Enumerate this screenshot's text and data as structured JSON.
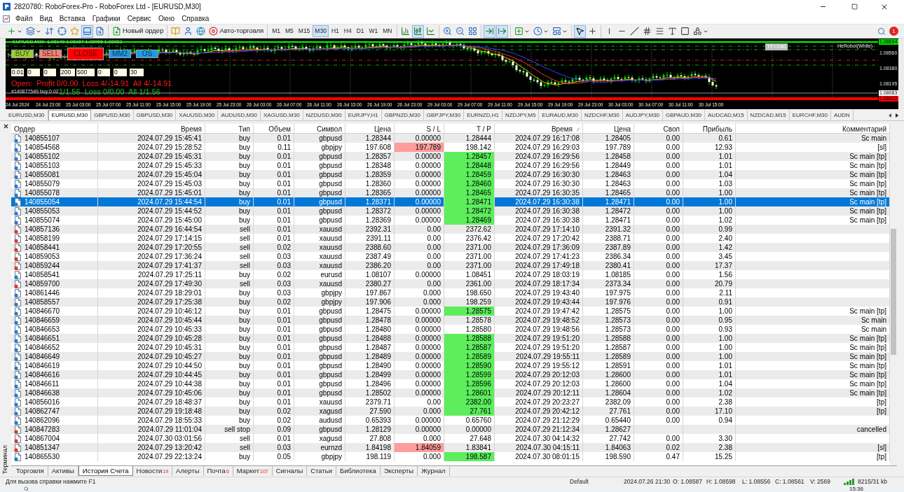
{
  "window": {
    "title": "2820780: RoboForex-Pro - RoboForex Ltd - [EURUSD,M30]"
  },
  "menu": [
    "Файл",
    "Вид",
    "Вставка",
    "Графики",
    "Сервис",
    "Окно",
    "Справка"
  ],
  "toolbar": {
    "groups": [
      [
        {
          "kind": "new-chart",
          "selected": false
        },
        {
          "kind": "profiles",
          "selected": false
        },
        {
          "kind": "market-watch",
          "selected": false
        },
        {
          "kind": "data-window",
          "selected": false
        },
        {
          "kind": "navigator",
          "selected": false
        },
        {
          "kind": "terminal",
          "selected": true
        },
        {
          "kind": "tester",
          "selected": false
        }
      ],
      [
        {
          "kind": "new-order",
          "label": "Новый ордер",
          "selected": false
        }
      ],
      [
        {
          "kind": "editor",
          "selected": false
        },
        {
          "kind": "user",
          "selected": false
        },
        {
          "kind": "globe",
          "selected": false
        },
        {
          "kind": "auto-trading",
          "label": "Авто-торговля",
          "selected": false
        }
      ],
      [
        {
          "kind": "timeframe",
          "label": "M1",
          "selected": false
        },
        {
          "kind": "timeframe",
          "label": "M5",
          "selected": false
        },
        {
          "kind": "timeframe",
          "label": "M15",
          "selected": false
        },
        {
          "kind": "timeframe",
          "label": "M30",
          "selected": true
        },
        {
          "kind": "timeframe",
          "label": "H1",
          "selected": false
        },
        {
          "kind": "timeframe",
          "label": "H4",
          "selected": false
        },
        {
          "kind": "timeframe",
          "label": "D1",
          "selected": false
        },
        {
          "kind": "timeframe",
          "label": "W1",
          "selected": false
        },
        {
          "kind": "timeframe",
          "label": "MN",
          "selected": false
        }
      ],
      [
        {
          "kind": "bars",
          "selected": false
        },
        {
          "kind": "candles",
          "selected": true
        },
        {
          "kind": "line",
          "selected": false
        }
      ],
      [
        {
          "kind": "zoom-in",
          "selected": false
        },
        {
          "kind": "zoom-out",
          "selected": false
        },
        {
          "kind": "tile",
          "selected": false
        }
      ],
      [
        {
          "kind": "autoscroll",
          "selected": true
        },
        {
          "kind": "shift",
          "selected": true
        }
      ],
      [
        {
          "kind": "indicators",
          "selected": false
        },
        {
          "kind": "periods",
          "selected": false
        },
        {
          "kind": "templates",
          "selected": false
        }
      ],
      [
        {
          "kind": "cursor",
          "selected": true
        },
        {
          "kind": "crosshair",
          "selected": false
        }
      ],
      [
        {
          "kind": "vline",
          "selected": false
        },
        {
          "kind": "hline",
          "selected": false
        },
        {
          "kind": "trendline",
          "selected": false
        },
        {
          "kind": "channel",
          "selected": false
        },
        {
          "kind": "fibo",
          "selected": false
        },
        {
          "kind": "text",
          "selected": false
        },
        {
          "kind": "label",
          "selected": false
        },
        {
          "kind": "shapes",
          "selected": false
        }
      ]
    ],
    "notification_count": "1"
  },
  "chart": {
    "info_line": "EURUSD,M30  1.08149 1.08187 1.08066 1.08083",
    "buttons": [
      {
        "label": "BUY",
        "color": "#9acd32"
      },
      {
        "label": "SELL",
        "color": "#fa8072"
      },
      {
        "label": "CLOSE",
        "color": "#ff0000"
      },
      {
        "label": "MM2",
        "color": "#1e9be6"
      },
      {
        "label": "OS",
        "color": "#1e9be6"
      }
    ],
    "inputs": [
      "0.01",
      "0",
      "0",
      "200",
      "500",
      "0",
      "0",
      "30"
    ],
    "open_summary": "Open:  Profit 0/0.00  Loss 4/-14.91  All 4/-14.91",
    "order_note": "#140877549 buy 0.02",
    "closed_summary": "1/1.56  Loss 0/0.00  All 1/1.56",
    "tf_label": "TF=240",
    "robot_label": "HeRobot(White)",
    "price_labels": [
      {
        "text": "1.08694",
        "kind": "boxed",
        "color": "#00e000"
      },
      {
        "text": "1.08560",
        "kind": "plain"
      },
      {
        "text": "1.08380",
        "kind": "plain"
      },
      {
        "text": "1.08195",
        "kind": "plain"
      },
      {
        "text": "1.08083",
        "kind": "boxed",
        "color": "#ffffff"
      },
      {
        "text": "1.08022",
        "kind": "boxed",
        "color": "#ff0000"
      }
    ],
    "time_labels": [
      "24 Jul 2024",
      "24 Jul 23:00",
      "25 Jul 03:00",
      "25 Jul 07:00",
      "25 Jul 11:00",
      "25 Jul 15:00",
      "25 Jul 19:00",
      "25 Jul 23:00",
      "26 Jul 03:00",
      "26 Jul 07:00",
      "26 Jul 11:00",
      "26 Jul 15:00",
      "26 Jul 19:00",
      "26 Jul 23:00",
      "29 Jul 03:00",
      "29 Jul 07:00",
      "29 Jul 11:00",
      "29 Jul 15:00",
      "29 Jul 19:00",
      "29 Jul 23:00",
      "30 Jul 03:00",
      "30 Jul 07:00",
      "30 Jul 11:00",
      "30 Jul 15:00"
    ]
  },
  "symbol_tabs": [
    {
      "label": "EURUSD,M30",
      "selected": false
    },
    {
      "label": "EURUSD,M30",
      "selected": true
    },
    {
      "label": "GBPUSD,M30",
      "selected": false
    },
    {
      "label": "GBPUSD,M30",
      "selected": false
    },
    {
      "label": "XAUUSD,M30",
      "selected": false
    },
    {
      "label": "AUDUSD,M30",
      "selected": false
    },
    {
      "label": "XAGUSD,M30",
      "selected": false
    },
    {
      "label": "NZDUSD,M30",
      "selected": false
    },
    {
      "label": "EURJPY,H1",
      "selected": false
    },
    {
      "label": "GBPNZD,M30",
      "selected": false
    },
    {
      "label": "GBPJPY,M30",
      "selected": false
    },
    {
      "label": "EURNZD,H1",
      "selected": false
    },
    {
      "label": "NZDJPY,M5",
      "selected": false
    },
    {
      "label": "EURAUD,M30",
      "selected": false
    },
    {
      "label": "NZDCHF,M30",
      "selected": false
    },
    {
      "label": "AUDJPY,M30",
      "selected": false
    },
    {
      "label": "GBPAUD,M30",
      "selected": false
    },
    {
      "label": "AUDCAD,M15",
      "selected": false
    },
    {
      "label": "NZDCAD,M15",
      "selected": false
    },
    {
      "label": "EURCHF,M30",
      "selected": false
    },
    {
      "label": "AUDN",
      "selected": false
    }
  ],
  "terminal": {
    "label": "Терминал",
    "columns": [
      {
        "label": "Ордер",
        "sorted": false
      },
      {
        "label": "Время",
        "sorted": false
      },
      {
        "label": "Тип",
        "sorted": false
      },
      {
        "label": "Объем",
        "sorted": false
      },
      {
        "label": "Символ",
        "sorted": false
      },
      {
        "label": "Цена",
        "sorted": false
      },
      {
        "label": "S / L",
        "sorted": false
      },
      {
        "label": "T / P",
        "sorted": false
      },
      {
        "label": "Время",
        "sorted": true
      },
      {
        "label": "Цена",
        "sorted": false
      },
      {
        "label": "Своп",
        "sorted": false
      },
      {
        "label": "Прибыль",
        "sorted": false
      },
      {
        "label": "Комментарий",
        "sorted": false
      }
    ],
    "rows": [
      {
        "order": "140855107",
        "open_time": "2024.07.29 15:45:41",
        "type": "buy",
        "volume": "0.01",
        "symbol": "gbpusd",
        "open_price": "1.28344",
        "sl": "0.00000",
        "tp": "1.28444",
        "close_time": "2024.07.29 16:17:08",
        "close_price": "1.28405",
        "swap": "0.00",
        "profit": "0.61",
        "comment": "Sc main",
        "kind": "buy",
        "selected": false,
        "sl_hit": false,
        "tp_hit": false
      },
      {
        "order": "140854568",
        "open_time": "2024.07.29 15:28:52",
        "type": "buy",
        "volume": "0.11",
        "symbol": "gbpjpy",
        "open_price": "197.608",
        "sl": "197.789",
        "tp": "198.142",
        "close_time": "2024.07.29 16:29:03",
        "close_price": "197.789",
        "swap": "0.00",
        "profit": "12.93",
        "comment": "[sl]",
        "kind": "buy",
        "selected": false,
        "sl_hit": true,
        "tp_hit": false
      },
      {
        "order": "140855102",
        "open_time": "2024.07.29 15:45:31",
        "type": "buy",
        "volume": "0.01",
        "symbol": "gbpusd",
        "open_price": "1.28357",
        "sl": "0.00000",
        "tp": "1.28457",
        "close_time": "2024.07.29 16:29:56",
        "close_price": "1.28458",
        "swap": "0.00",
        "profit": "1.01",
        "comment": "Sc main [tp]",
        "kind": "buy",
        "selected": false,
        "sl_hit": false,
        "tp_hit": true
      },
      {
        "order": "140855103",
        "open_time": "2024.07.29 15:45:33",
        "type": "buy",
        "volume": "0.01",
        "symbol": "gbpusd",
        "open_price": "1.28348",
        "sl": "0.00000",
        "tp": "1.28448",
        "close_time": "2024.07.29 16:29:56",
        "close_price": "1.28449",
        "swap": "0.00",
        "profit": "1.01",
        "comment": "Sc main [tp]",
        "kind": "buy",
        "selected": false,
        "sl_hit": false,
        "tp_hit": true
      },
      {
        "order": "140855081",
        "open_time": "2024.07.29 15:45:04",
        "type": "buy",
        "volume": "0.01",
        "symbol": "gbpusd",
        "open_price": "1.28359",
        "sl": "0.00000",
        "tp": "1.28459",
        "close_time": "2024.07.29 16:30:30",
        "close_price": "1.28463",
        "swap": "0.00",
        "profit": "1.04",
        "comment": "Sc main [tp]",
        "kind": "buy",
        "selected": false,
        "sl_hit": false,
        "tp_hit": true
      },
      {
        "order": "140855079",
        "open_time": "2024.07.29 15:45:03",
        "type": "buy",
        "volume": "0.01",
        "symbol": "gbpusd",
        "open_price": "1.28360",
        "sl": "0.00000",
        "tp": "1.28460",
        "close_time": "2024.07.29 16:30:30",
        "close_price": "1.28463",
        "swap": "0.00",
        "profit": "1.03",
        "comment": "Sc main [tp]",
        "kind": "buy",
        "selected": false,
        "sl_hit": false,
        "tp_hit": true
      },
      {
        "order": "140855078",
        "open_time": "2024.07.29 15:45:01",
        "type": "buy",
        "volume": "0.01",
        "symbol": "gbpusd",
        "open_price": "1.28365",
        "sl": "0.00000",
        "tp": "1.28465",
        "close_time": "2024.07.29 16:30:35",
        "close_price": "1.28465",
        "swap": "0.00",
        "profit": "1.00",
        "comment": "Sc main [tp]",
        "kind": "buy",
        "selected": false,
        "sl_hit": false,
        "tp_hit": true
      },
      {
        "order": "140855054",
        "open_time": "2024.07.29 15:44:54",
        "type": "buy",
        "volume": "0.01",
        "symbol": "gbpusd",
        "open_price": "1.28371",
        "sl": "0.00000",
        "tp": "1.28471",
        "close_time": "2024.07.29 16:30:38",
        "close_price": "1.28471",
        "swap": "0.00",
        "profit": "1.00",
        "comment": "Sc main [tp]",
        "kind": "buy",
        "selected": true,
        "sl_hit": false,
        "tp_hit": true
      },
      {
        "order": "140855053",
        "open_time": "2024.07.29 15:44:52",
        "type": "buy",
        "volume": "0.01",
        "symbol": "gbpusd",
        "open_price": "1.28372",
        "sl": "0.00000",
        "tp": "1.28472",
        "close_time": "2024.07.29 16:30:38",
        "close_price": "1.28472",
        "swap": "0.00",
        "profit": "1.00",
        "comment": "Sc main [tp]",
        "kind": "buy",
        "selected": false,
        "sl_hit": false,
        "tp_hit": true
      },
      {
        "order": "140855074",
        "open_time": "2024.07.29 15:45:00",
        "type": "buy",
        "volume": "0.01",
        "symbol": "gbpusd",
        "open_price": "1.28369",
        "sl": "0.00000",
        "tp": "1.28469",
        "close_time": "2024.07.29 16:30:38",
        "close_price": "1.28471",
        "swap": "0.00",
        "profit": "1.02",
        "comment": "Sc main [tp]",
        "kind": "buy",
        "selected": false,
        "sl_hit": false,
        "tp_hit": true
      },
      {
        "order": "140857136",
        "open_time": "2024.07.29 16:44:54",
        "type": "sell",
        "volume": "0.01",
        "symbol": "xauusd",
        "open_price": "2392.31",
        "sl": "0.00",
        "tp": "2372.62",
        "close_time": "2024.07.29 17:14:10",
        "close_price": "2391.32",
        "swap": "0.00",
        "profit": "0.99",
        "kind": "sell",
        "selected": false,
        "sl_hit": false,
        "tp_hit": false
      },
      {
        "order": "140858199",
        "open_time": "2024.07.29 17:14:15",
        "type": "sell",
        "volume": "0.01",
        "symbol": "xauusd",
        "open_price": "2391.11",
        "sl": "0.00",
        "tp": "2376.42",
        "close_time": "2024.07.29 17:20:42",
        "close_price": "2388.71",
        "swap": "0.00",
        "profit": "2.40",
        "kind": "sell",
        "selected": false,
        "sl_hit": false,
        "tp_hit": false
      },
      {
        "order": "140858441",
        "open_time": "2024.07.29 17:20:55",
        "type": "sell",
        "volume": "0.02",
        "symbol": "xauusd",
        "open_price": "2388.60",
        "sl": "0.00",
        "tp": "2371.00",
        "close_time": "2024.07.29 17:36:09",
        "close_price": "2387.89",
        "swap": "0.00",
        "profit": "1.42",
        "kind": "sell",
        "selected": false,
        "sl_hit": false,
        "tp_hit": false
      },
      {
        "order": "140859053",
        "open_time": "2024.07.29 17:36:24",
        "type": "sell",
        "volume": "0.03",
        "symbol": "xauusd",
        "open_price": "2387.49",
        "sl": "0.00",
        "tp": "2371.00",
        "close_time": "2024.07.29 17:41:23",
        "close_price": "2386.34",
        "swap": "0.00",
        "profit": "3.45",
        "kind": "sell",
        "selected": false,
        "sl_hit": false,
        "tp_hit": false
      },
      {
        "order": "140859244",
        "open_time": "2024.07.29 17:41:37",
        "type": "sell",
        "volume": "0.03",
        "symbol": "xauusd",
        "open_price": "2386.20",
        "sl": "0.00",
        "tp": "2371.00",
        "close_time": "2024.07.29 17:49:18",
        "close_price": "2380.41",
        "swap": "0.00",
        "profit": "17.37",
        "kind": "sell",
        "selected": false,
        "sl_hit": false,
        "tp_hit": false
      },
      {
        "order": "140858541",
        "open_time": "2024.07.29 17:25:11",
        "type": "buy",
        "volume": "0.02",
        "symbol": "eurusd",
        "open_price": "1.08107",
        "sl": "0.00000",
        "tp": "1.08451",
        "close_time": "2024.07.29 18:03:19",
        "close_price": "1.08185",
        "swap": "0.00",
        "profit": "1.56",
        "kind": "buy",
        "selected": false,
        "sl_hit": false,
        "tp_hit": false
      },
      {
        "order": "140859700",
        "open_time": "2024.07.29 17:49:30",
        "type": "sell",
        "volume": "0.03",
        "symbol": "xauusd",
        "open_price": "2380.27",
        "sl": "0.00",
        "tp": "2361.00",
        "close_time": "2024.07.29 18:17:34",
        "close_price": "2373.34",
        "swap": "0.00",
        "profit": "20.79",
        "kind": "sell",
        "selected": false,
        "sl_hit": false,
        "tp_hit": false
      },
      {
        "order": "140861446",
        "open_time": "2024.07.29 18:29:01",
        "type": "buy",
        "volume": "0.03",
        "symbol": "gbpjpy",
        "open_price": "197.867",
        "sl": "0.000",
        "tp": "198.650",
        "close_time": "2024.07.29 19:43:40",
        "close_price": "197.975",
        "swap": "0.00",
        "profit": "2.11",
        "kind": "buy",
        "selected": false,
        "sl_hit": false,
        "tp_hit": false
      },
      {
        "order": "140858557",
        "open_time": "2024.07.29 17:25:38",
        "type": "buy",
        "volume": "0.02",
        "symbol": "gbpjpy",
        "open_price": "197.906",
        "sl": "0.000",
        "tp": "198.259",
        "close_time": "2024.07.29 19:43:44",
        "close_price": "197.976",
        "swap": "0.00",
        "profit": "0.91",
        "kind": "buy",
        "selected": false,
        "sl_hit": false,
        "tp_hit": false
      },
      {
        "order": "140846670",
        "open_time": "2024.07.29 10:46:12",
        "type": "buy",
        "volume": "0.01",
        "symbol": "gbpusd",
        "open_price": "1.28475",
        "sl": "0.00000",
        "tp": "1.28575",
        "close_time": "2024.07.29 19:47:42",
        "close_price": "1.28575",
        "swap": "0.00",
        "profit": "1.00",
        "comment": "Sc main [tp]",
        "kind": "buy",
        "selected": false,
        "sl_hit": false,
        "tp_hit": true
      },
      {
        "order": "140846659",
        "open_time": "2024.07.29 10:45:44",
        "type": "buy",
        "volume": "0.01",
        "symbol": "gbpusd",
        "open_price": "1.28478",
        "sl": "0.00000",
        "tp": "1.28578",
        "close_time": "2024.07.29 19:48:52",
        "close_price": "1.28573",
        "swap": "0.00",
        "profit": "0.95",
        "comment": "Sc main",
        "kind": "buy",
        "selected": false,
        "sl_hit": false,
        "tp_hit": false
      },
      {
        "order": "140846653",
        "open_time": "2024.07.29 10:45:33",
        "type": "buy",
        "volume": "0.01",
        "symbol": "gbpusd",
        "open_price": "1.28480",
        "sl": "0.00000",
        "tp": "1.28580",
        "close_time": "2024.07.29 19:48:56",
        "close_price": "1.28573",
        "swap": "0.00",
        "profit": "0.93",
        "comment": "Sc main",
        "kind": "buy",
        "selected": false,
        "sl_hit": false,
        "tp_hit": false
      },
      {
        "order": "140846651",
        "open_time": "2024.07.29 10:45:28",
        "type": "buy",
        "volume": "0.01",
        "symbol": "gbpusd",
        "open_price": "1.28488",
        "sl": "0.00000",
        "tp": "1.28588",
        "close_time": "2024.07.29 19:51:20",
        "close_price": "1.28588",
        "swap": "0.00",
        "profit": "1.00",
        "comment": "Sc main [tp]",
        "kind": "buy",
        "selected": false,
        "sl_hit": false,
        "tp_hit": true
      },
      {
        "order": "140846652",
        "open_time": "2024.07.29 10:45:31",
        "type": "buy",
        "volume": "0.01",
        "symbol": "gbpusd",
        "open_price": "1.28487",
        "sl": "0.00000",
        "tp": "1.28587",
        "close_time": "2024.07.29 19:51:20",
        "close_price": "1.28587",
        "swap": "0.00",
        "profit": "1.00",
        "comment": "Sc main [tp]",
        "kind": "buy",
        "selected": false,
        "sl_hit": false,
        "tp_hit": true
      },
      {
        "order": "140846649",
        "open_time": "2024.07.29 10:45:27",
        "type": "buy",
        "volume": "0.01",
        "symbol": "gbpusd",
        "open_price": "1.28489",
        "sl": "0.00000",
        "tp": "1.28589",
        "close_time": "2024.07.29 19:55:11",
        "close_price": "1.28589",
        "swap": "0.00",
        "profit": "1.00",
        "comment": "Sc main [tp]",
        "kind": "buy",
        "selected": false,
        "sl_hit": false,
        "tp_hit": true
      },
      {
        "order": "140846619",
        "open_time": "2024.07.29 10:44:50",
        "type": "buy",
        "volume": "0.01",
        "symbol": "gbpusd",
        "open_price": "1.28490",
        "sl": "0.00000",
        "tp": "1.28590",
        "close_time": "2024.07.29 19:55:12",
        "close_price": "1.28591",
        "swap": "0.00",
        "profit": "1.01",
        "comment": "Sc main [tp]",
        "kind": "buy",
        "selected": false,
        "sl_hit": false,
        "tp_hit": true
      },
      {
        "order": "140846616",
        "open_time": "2024.07.29 10:44:45",
        "type": "buy",
        "volume": "0.01",
        "symbol": "gbpusd",
        "open_price": "1.28499",
        "sl": "0.00000",
        "tp": "1.28599",
        "close_time": "2024.07.29 20:12:03",
        "close_price": "1.28600",
        "swap": "0.00",
        "profit": "1.01",
        "comment": "Sc main [tp]",
        "kind": "buy",
        "selected": false,
        "sl_hit": false,
        "tp_hit": true
      },
      {
        "order": "140846611",
        "open_time": "2024.07.29 10:44:38",
        "type": "buy",
        "volume": "0.01",
        "symbol": "gbpusd",
        "open_price": "1.28496",
        "sl": "0.00000",
        "tp": "1.28596",
        "close_time": "2024.07.29 20:12:03",
        "close_price": "1.28600",
        "swap": "0.00",
        "profit": "1.04",
        "comment": "Sc main [tp]",
        "kind": "buy",
        "selected": false,
        "sl_hit": false,
        "tp_hit": true
      },
      {
        "order": "140846638",
        "open_time": "2024.07.29 10:45:06",
        "type": "buy",
        "volume": "0.01",
        "symbol": "gbpusd",
        "open_price": "1.28502",
        "sl": "0.00000",
        "tp": "1.28601",
        "close_time": "2024.07.29 20:12:11",
        "close_price": "1.28604",
        "swap": "0.00",
        "profit": "1.02",
        "comment": "Sc main [tp]",
        "kind": "buy",
        "selected": false,
        "sl_hit": false,
        "tp_hit": true
      },
      {
        "order": "140856016",
        "open_time": "2024.07.29 18:48:37",
        "type": "buy",
        "volume": "0.01",
        "symbol": "xauusd",
        "open_price": "2379.71",
        "sl": "0.00",
        "tp": "2382.00",
        "close_time": "2024.07.29 20:23:27",
        "close_price": "2382.09",
        "swap": "0.00",
        "profit": "2.38",
        "comment": "[tp]",
        "kind": "buy",
        "selected": false,
        "sl_hit": false,
        "tp_hit": true
      },
      {
        "order": "140862747",
        "open_time": "2024.07.29 19:18:48",
        "type": "buy",
        "volume": "0.02",
        "symbol": "xagusd",
        "open_price": "27.590",
        "sl": "0.000",
        "tp": "27.761",
        "close_time": "2024.07.29 20:42:12",
        "close_price": "27.761",
        "swap": "0.00",
        "profit": "17.10",
        "comment": "[tp]",
        "kind": "buy",
        "selected": false,
        "sl_hit": false,
        "tp_hit": true
      },
      {
        "order": "140862096",
        "open_time": "2024.07.29 18:55:33",
        "type": "buy",
        "volume": "0.02",
        "symbol": "audusd",
        "open_price": "0.65393",
        "sl": "0.00000",
        "tp": "0.65760",
        "close_time": "2024.07.29 21:12:29",
        "close_price": "0.65440",
        "swap": "0.00",
        "profit": "0.94",
        "kind": "buy",
        "selected": false,
        "sl_hit": false,
        "tp_hit": false
      },
      {
        "order": "140847283",
        "open_time": "2024.07.29 11:01:04",
        "type": "sell stop",
        "volume": "0.09",
        "symbol": "gbpusd",
        "open_price": "1.28129",
        "sl": "0.00000",
        "tp": "0.00000",
        "close_time": "2024.07.29 21:12:34",
        "close_price": "1.28627",
        "comment": "cancelled",
        "kind": "sell",
        "selected": false,
        "sl_hit": false,
        "tp_hit": false
      },
      {
        "order": "140867004",
        "open_time": "2024.07.30 03:01:56",
        "type": "sell",
        "volume": "0.01",
        "symbol": "xagusd",
        "open_price": "27.808",
        "sl": "0.000",
        "tp": "27.648",
        "close_time": "2024.07.30 04:14:32",
        "close_price": "27.742",
        "swap": "0.00",
        "profit": "3.30",
        "kind": "sell",
        "selected": false,
        "sl_hit": false,
        "tp_hit": false
      },
      {
        "order": "140851347",
        "open_time": "2024.07.29 13:20:42",
        "type": "sell",
        "volume": "0.03",
        "symbol": "eurnzd",
        "open_price": "1.84198",
        "sl": "1.84059",
        "tp": "1.83841",
        "close_time": "2024.07.30 04:15:11",
        "close_price": "1.84063",
        "swap": "0.02",
        "profit": "2.38",
        "comment": "[sl]",
        "kind": "sell",
        "selected": false,
        "sl_hit": true,
        "tp_hit": false
      },
      {
        "order": "140865530",
        "open_time": "2024.07.29 22:13:24",
        "type": "buy",
        "volume": "0.05",
        "symbol": "gbpjpy",
        "open_price": "198.119",
        "sl": "0.000",
        "tp": "198.587",
        "close_time": "2024.07.30 08:01:15",
        "close_price": "198.590",
        "swap": "0.47",
        "profit": "15.25",
        "comment": "[tp]",
        "kind": "buy",
        "selected": false,
        "sl_hit": false,
        "tp_hit": true
      }
    ],
    "tabs": [
      {
        "label": "Торговля",
        "selected": false
      },
      {
        "label": "Активы",
        "selected": false
      },
      {
        "label": "История Счета",
        "selected": true
      },
      {
        "label": "Новости",
        "badge": "19",
        "selected": false
      },
      {
        "label": "Алерты",
        "selected": false
      },
      {
        "label": "Почта",
        "badge": "6",
        "selected": false
      },
      {
        "label": "Маркет",
        "badge": "107",
        "selected": false
      },
      {
        "label": "Сигналы",
        "selected": false
      },
      {
        "label": "Статьи",
        "selected": false
      },
      {
        "label": "Библиотека",
        "selected": false
      },
      {
        "label": "Эксперты",
        "selected": false
      },
      {
        "label": "Журнал",
        "selected": false
      }
    ]
  },
  "status_bar": {
    "hint": "Для вызова справки нажмите F1",
    "profile": "Default",
    "bar_time": "2024.07.26 21:30",
    "open": "O: 1.08587",
    "high": "H: 1.08598",
    "low": "L: 1.08556",
    "close": "C: 1.08561",
    "volume": "V: 2569",
    "traffic": "8215/31 kb"
  },
  "taskbar": {
    "clock": "15:36"
  }
}
